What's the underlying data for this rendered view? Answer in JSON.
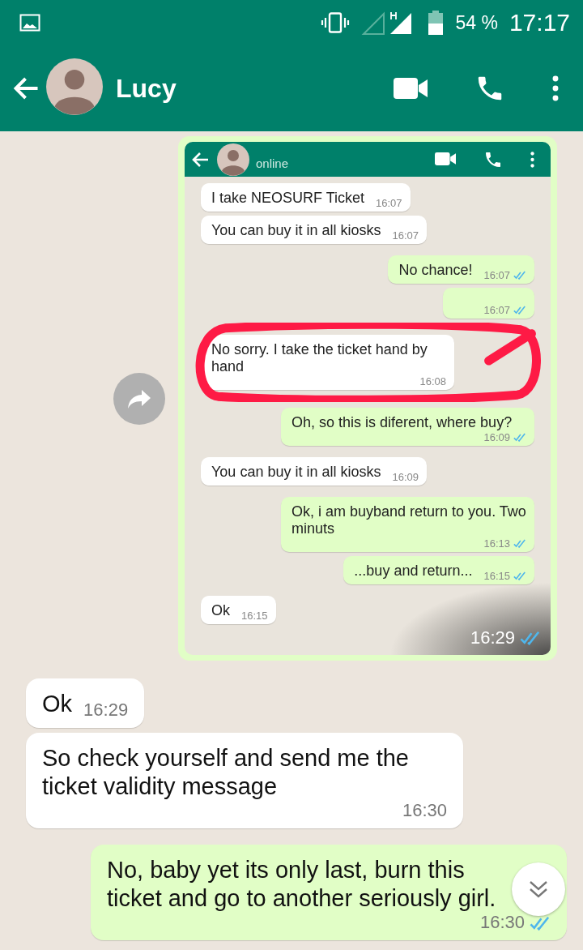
{
  "status_bar": {
    "battery": "54 %",
    "time": "17:17"
  },
  "header": {
    "contact_name": "Lucy"
  },
  "shared_image": {
    "header": {
      "status": "online"
    },
    "messages": [
      {
        "kind": "incoming",
        "text": "I take NEOSURF Ticket",
        "time": "16:07"
      },
      {
        "kind": "incoming",
        "text": "You can buy it in all kiosks",
        "time": "16:07"
      },
      {
        "kind": "outgoing",
        "text": "No chance!",
        "time": "16:07",
        "read": true
      },
      {
        "kind": "outgoing",
        "time": "16:07",
        "read": true
      },
      {
        "kind": "incoming",
        "text": "No sorry. I take the ticket hand by hand",
        "time": "16:08",
        "circled": true
      },
      {
        "kind": "outgoing",
        "text": "Oh, so this is diferent, where buy?",
        "time": "16:09",
        "read": true
      },
      {
        "kind": "incoming",
        "text": "You can buy it in all kiosks",
        "time": "16:09"
      },
      {
        "kind": "outgoing",
        "text": "Ok, i am buyband return to you. Two minuts",
        "time": "16:13",
        "read": true
      },
      {
        "kind": "outgoing",
        "text": "...buy and return...",
        "time": "16:15",
        "read": true
      },
      {
        "kind": "incoming",
        "text": "Ok",
        "time": "16:15"
      }
    ],
    "time": "16:29",
    "read": true
  },
  "messages": [
    {
      "kind": "incoming",
      "text": "Ok",
      "time": "16:29"
    },
    {
      "kind": "incoming",
      "text": "So check yourself and send me the ticket validity message",
      "time": "16:30"
    },
    {
      "kind": "outgoing",
      "text": "No, baby yet its only last, burn this ticket and go to another seriously girl.",
      "time": "16:30",
      "read": true
    }
  ]
}
